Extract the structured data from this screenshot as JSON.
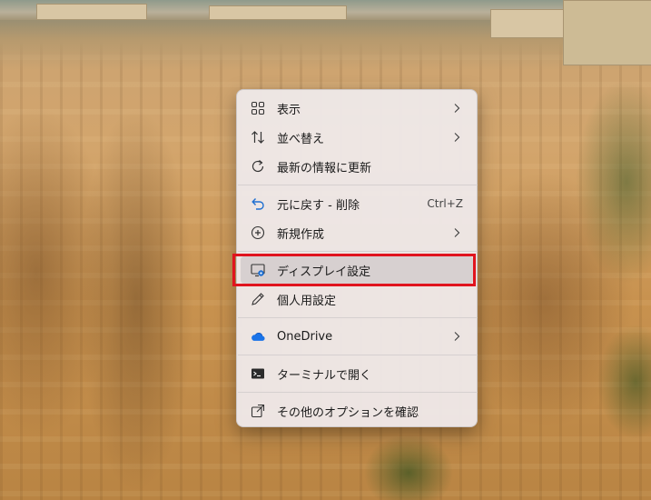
{
  "context_menu": {
    "items": [
      {
        "label": "表示",
        "icon": "grid-icon",
        "has_submenu": true
      },
      {
        "label": "並べ替え",
        "icon": "sort-icon",
        "has_submenu": true
      },
      {
        "label": "最新の情報に更新",
        "icon": "refresh-icon",
        "has_submenu": false
      },
      {
        "label": "元に戻す - 削除",
        "icon": "undo-icon",
        "shortcut": "Ctrl+Z"
      },
      {
        "label": "新規作成",
        "icon": "add-circle-icon",
        "has_submenu": true
      },
      {
        "label": "ディスプレイ設定",
        "icon": "display-settings-icon",
        "has_submenu": false
      },
      {
        "label": "個人用設定",
        "icon": "pen-icon",
        "has_submenu": false
      },
      {
        "label": "OneDrive",
        "icon": "onedrive-cloud-icon",
        "has_submenu": true
      },
      {
        "label": "ターミナルで開く",
        "icon": "terminal-icon",
        "has_submenu": false
      },
      {
        "label": "その他のオプションを確認",
        "icon": "share-icon",
        "has_submenu": false
      }
    ]
  },
  "highlight": {
    "target": "ディスプレイ設定",
    "color": "#e0141e"
  },
  "colors": {
    "menu_background": "#eee8e8",
    "onedrive_blue": "#1a73e8",
    "undo_blue": "#1f6fd1",
    "text": "#1a1a1a"
  }
}
